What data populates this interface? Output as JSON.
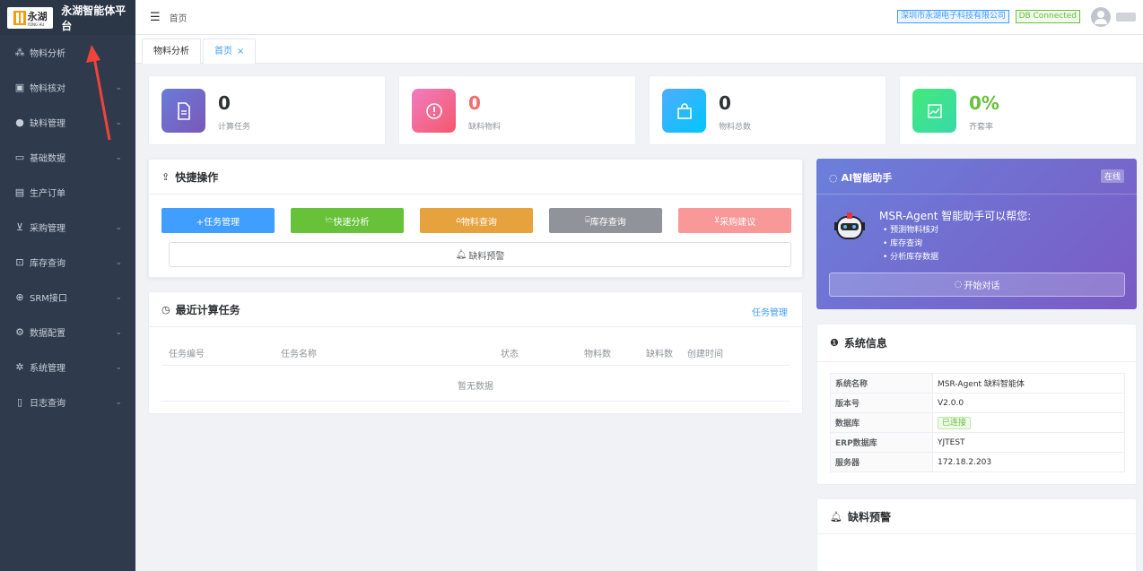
{
  "sidebar": {
    "logo_text": "永湖",
    "logo_sub": "YONG HU",
    "title": "永湖智能体平台",
    "items": [
      {
        "label": "物料分析",
        "icon": "sparkle-icon",
        "has_children": false
      },
      {
        "label": "物料核对",
        "icon": "clipboard-check-icon",
        "has_children": true
      },
      {
        "label": "缺料管理",
        "icon": "alert-circle-icon",
        "has_children": true
      },
      {
        "label": "基础数据",
        "icon": "folder-icon",
        "has_children": true
      },
      {
        "label": "生产订单",
        "icon": "document-icon",
        "has_children": false
      },
      {
        "label": "采购管理",
        "icon": "cart-icon",
        "has_children": true
      },
      {
        "label": "库存查询",
        "icon": "box-icon",
        "has_children": true
      },
      {
        "label": "SRM接口",
        "icon": "link-icon",
        "has_children": true
      },
      {
        "label": "数据配置",
        "icon": "settings-icon",
        "has_children": true
      },
      {
        "label": "系统管理",
        "icon": "gear-icon",
        "has_children": true
      },
      {
        "label": "日志查询",
        "icon": "log-icon",
        "has_children": true
      }
    ]
  },
  "header": {
    "breadcrumb": "首页",
    "company": "深圳市永湖电子科技有限公司",
    "db_status": "DB Connected"
  },
  "tabs": [
    {
      "label": "物料分析",
      "active": false
    },
    {
      "label": "首页",
      "active": true,
      "close": "×"
    }
  ],
  "stats": [
    {
      "value": "0",
      "label": "计算任务",
      "icon": "document-icon",
      "value_color": "#303133"
    },
    {
      "value": "0",
      "label": "缺料物料",
      "icon": "alert-circle-icon",
      "value_color": "#f56c6c"
    },
    {
      "value": "0",
      "label": "物料总数",
      "icon": "bag-icon",
      "value_color": "#303133"
    },
    {
      "value": "0%",
      "label": "齐套率",
      "icon": "chart-icon",
      "value_color": "#67c23a"
    }
  ],
  "quick": {
    "title": "快捷操作",
    "buttons": [
      {
        "label": "+任务管理",
        "color": "#409eff"
      },
      {
        "label": "快速分析",
        "color": "#67c23a"
      },
      {
        "label": "物料查询",
        "color": "#e6a23c"
      },
      {
        "label": "库存查询",
        "color": "#909399"
      },
      {
        "label": "采购建议",
        "color": "#f89898"
      }
    ],
    "alert_button": "缺料预警"
  },
  "recent": {
    "title": "最近计算任务",
    "link": "任务管理",
    "columns": [
      "任务编号",
      "任务名称",
      "状态",
      "物料数",
      "缺料数",
      "创建时间"
    ],
    "empty": "暂无数据"
  },
  "ai": {
    "title": "AI智能助手",
    "badge": "在线",
    "headline": "MSR-Agent 智能助手可以帮您:",
    "features": [
      "预测物料核对",
      "库存查询",
      "分析库存数据"
    ],
    "button": "开始对话"
  },
  "sysinfo": {
    "title": "系统信息",
    "rows": [
      {
        "key": "系统名称",
        "value": "MSR-Agent 缺料智能体"
      },
      {
        "key": "版本号",
        "value": "V2.0.0"
      },
      {
        "key": "数据库",
        "value": "已连接",
        "tag": true
      },
      {
        "key": "ERP数据库",
        "value": "YJTEST"
      },
      {
        "key": "服务器",
        "value": "172.18.2.203"
      }
    ]
  },
  "alerts": {
    "title": "缺料预警"
  }
}
